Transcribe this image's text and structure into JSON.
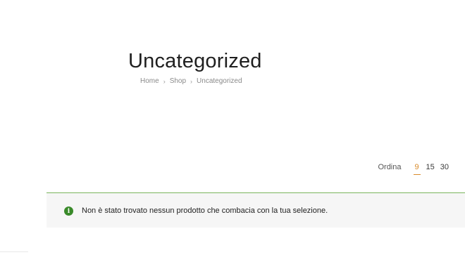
{
  "header": {
    "title": "Uncategorized"
  },
  "breadcrumb": {
    "items": [
      {
        "label": "Home"
      },
      {
        "label": "Shop"
      },
      {
        "label": "Uncategorized"
      }
    ],
    "separator": "›"
  },
  "per_page": {
    "label": "Ordina",
    "options": [
      "9",
      "15",
      "30"
    ],
    "selected": "9"
  },
  "notice": {
    "icon": "info-icon",
    "icon_glyph": "i",
    "text": "Non è stato trovato nessun prodotto che combacia con la tua selezione.",
    "accent_color": "#7ab55c"
  },
  "colors": {
    "active_option": "#d98b2b",
    "notice_icon": "#3a8a2a"
  }
}
